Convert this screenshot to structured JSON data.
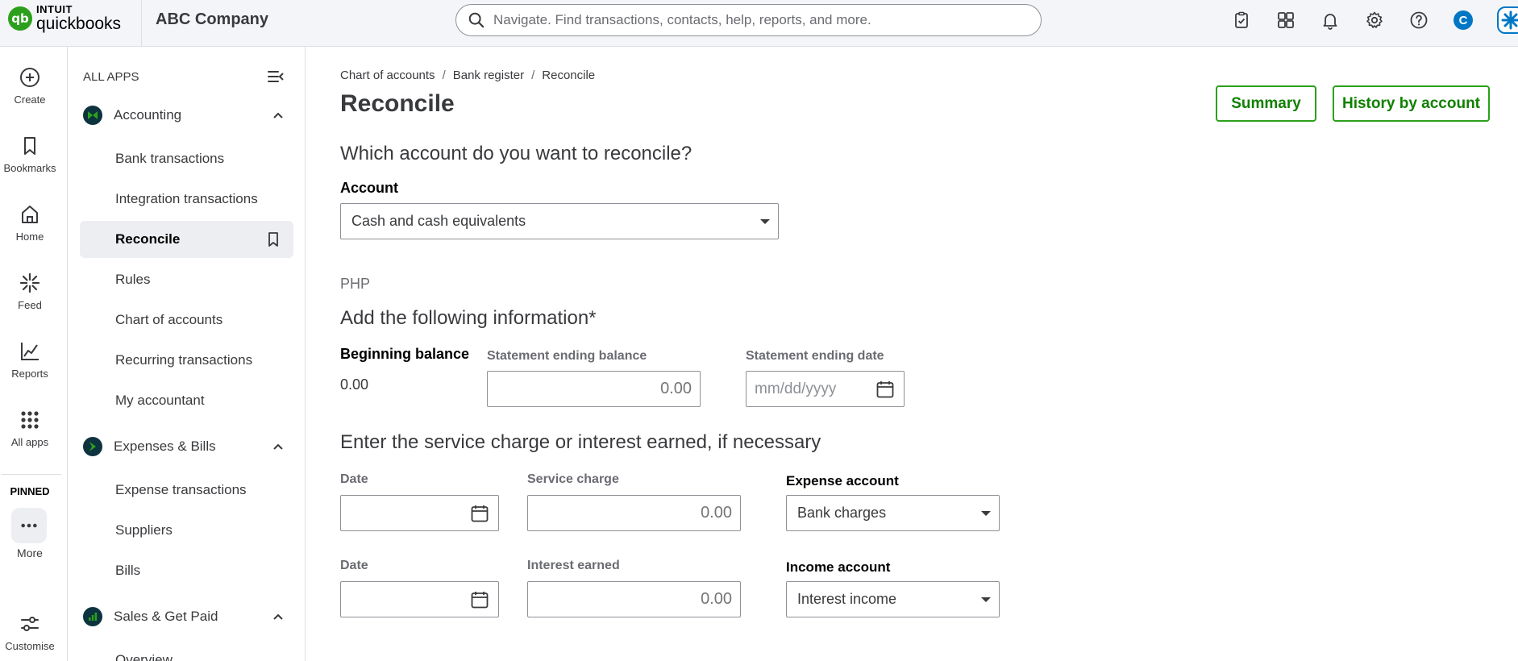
{
  "header": {
    "brand_top": "INTUIT",
    "brand_bottom": "quickbooks",
    "company": "ABC Company",
    "search_placeholder": "Navigate. Find transactions, contacts, help, reports, and more.",
    "avatar_initial": "C",
    "icons": [
      "task-icon",
      "apps-switch-icon",
      "bell-icon",
      "gear-icon",
      "help-icon",
      "avatar",
      "ai-assistant-icon"
    ]
  },
  "rail": {
    "items": [
      {
        "label": "Create",
        "icon": "plus-circle-icon"
      },
      {
        "label": "Bookmarks",
        "icon": "bookmark-icon"
      },
      {
        "label": "Home",
        "icon": "home-icon"
      },
      {
        "label": "Feed",
        "icon": "feed-icon"
      },
      {
        "label": "Reports",
        "icon": "reports-icon"
      },
      {
        "label": "All apps",
        "icon": "grid-icon"
      }
    ],
    "pinned": "PINNED",
    "more": "More",
    "customise": "Customise"
  },
  "sidebar": {
    "title": "ALL APPS",
    "sections": [
      {
        "label": "Accounting",
        "color": "#0d333f"
      },
      {
        "label": "Expenses & Bills",
        "color": "#0d333f"
      },
      {
        "label": "Sales & Get Paid",
        "color": "#0d333f"
      }
    ],
    "accounting_items": [
      "Bank transactions",
      "Integration transactions",
      "Reconcile",
      "Rules",
      "Chart of accounts",
      "Recurring transactions",
      "My accountant"
    ],
    "expense_items": [
      "Expense transactions",
      "Suppliers",
      "Bills"
    ],
    "sales_items": [
      "Overview"
    ]
  },
  "main": {
    "breadcrumb": [
      "Chart of accounts",
      "Bank register",
      "Reconcile"
    ],
    "title": "Reconcile",
    "buttons": {
      "summary": "Summary",
      "history": "History by account"
    },
    "q_account": "Which account do you want to reconcile?",
    "account_label": "Account",
    "account_value": "Cash and cash equivalents",
    "currency": "PHP",
    "add_info": "Add the following information*",
    "beginning_balance_label": "Beginning balance",
    "beginning_balance_value": "0.00",
    "statement_balance_label": "Statement ending balance",
    "statement_balance_value": "0.00",
    "statement_date_label": "Statement ending date",
    "statement_date_placeholder": "mm/dd/yyyy",
    "service_heading": "Enter the service charge or interest earned, if necessary",
    "date_label": "Date",
    "service_charge_label": "Service charge",
    "service_charge_value": "0.00",
    "expense_account_label": "Expense account",
    "expense_account_value": "Bank charges",
    "interest_label": "Interest earned",
    "interest_value": "0.00",
    "income_account_label": "Income account",
    "income_account_value": "Interest income"
  },
  "colors": {
    "brand_green": "#2ca01c",
    "button_text": "#108000",
    "avatar": "#0077c5"
  }
}
